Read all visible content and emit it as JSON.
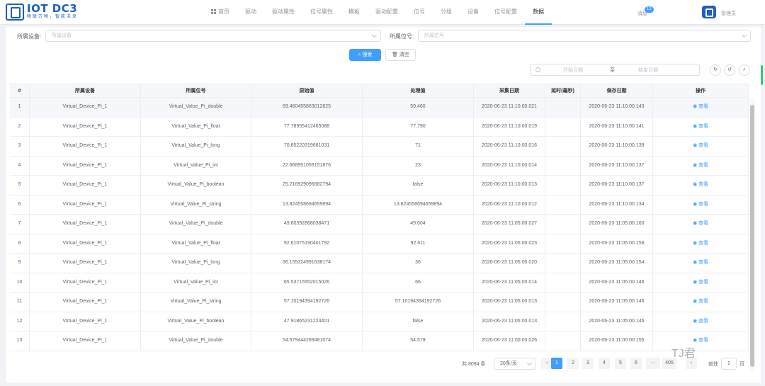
{
  "app": {
    "title": "IOT DC3",
    "subtitle": "物联万物，智能未来"
  },
  "nav": [
    {
      "label": "首页",
      "icon": "grid-icon"
    },
    {
      "label": "驱动"
    },
    {
      "label": "驱动属性"
    },
    {
      "label": "位号属性"
    },
    {
      "label": "模板"
    },
    {
      "label": "驱动配置"
    },
    {
      "label": "位号"
    },
    {
      "label": "分组"
    },
    {
      "label": "设备"
    },
    {
      "label": "位号配置"
    },
    {
      "label": "数据",
      "active": true
    }
  ],
  "header": {
    "messages_label": "消息",
    "messages_count": "12",
    "user_name": "管理员"
  },
  "filters": {
    "device_label": "所属设备:",
    "device_placeholder": "所属设备",
    "point_label": "所属位号:",
    "point_placeholder": "所属位号",
    "search_label": "搜索",
    "clear_label": "清空",
    "start_date_placeholder": "开始日期",
    "range_sep": "至",
    "end_date_placeholder": "结束日期"
  },
  "table": {
    "columns": [
      "#",
      "所属设备",
      "所属位号",
      "原始值",
      "处理值",
      "采集日期",
      "延时(毫秒)",
      "保存日期",
      "操作"
    ],
    "action_label": "查看",
    "rows": [
      [
        "1",
        "Virtual_Device_Pi_1",
        "Virtual_Value_Pi_double",
        "59.460455863012825",
        "59.460",
        "2020-06-23 11:10:00.021",
        "",
        "2020-06-23 11:10:00.143"
      ],
      [
        "2",
        "Virtual_Device_Pi_1",
        "Virtual_Value_Pi_float",
        "77.78955412465088",
        "77.790",
        "2020-06-23 11:10:00.019",
        "",
        "2020-06-23 11:10:00.141"
      ],
      [
        "3",
        "Virtual_Device_Pi_1",
        "Virtual_Value_Pi_long",
        "70.85220319681031",
        "71",
        "2020-06-23 11:10:00.016",
        "",
        "2020-06-23 11:10:00.139"
      ],
      [
        "4",
        "Virtual_Device_Pi_1",
        "Virtual_Value_Pi_int",
        "22.668951059151876",
        "23",
        "2020-06-23 11:10:00.014",
        "",
        "2020-06-23 11:10:00.137"
      ],
      [
        "5",
        "Virtual_Device_Pi_1",
        "Virtual_Value_Pi_boolean",
        "25.216929096682794",
        "false",
        "2020-06-23 11:10:00.013",
        "",
        "2020-06-23 11:10:00.137"
      ],
      [
        "6",
        "Virtual_Device_Pi_1",
        "Virtual_Value_Pi_string",
        "13.824558694659894",
        "13.824558694659894",
        "2020-06-23 11:10:00.012",
        "",
        "2020-06-23 11:10:00.134"
      ],
      [
        "7",
        "Virtual_Device_Pi_1",
        "Virtual_Value_Pi_double",
        "49.60392868038471",
        "49.604",
        "2020-06-23 11:05:00.027",
        "",
        "2020-06-23 11:05:00.160"
      ],
      [
        "8",
        "Virtual_Device_Pi_1",
        "Virtual_Value_Pi_float",
        "92.61075190401792",
        "92.611",
        "2020-06-23 11:05:00.023",
        "",
        "2020-06-23 11:05:00.158"
      ],
      [
        "9",
        "Virtual_Device_Pi_1",
        "Virtual_Value_Pi_long",
        "36.155324991638174",
        "36",
        "2020-06-23 11:05:00.020",
        "",
        "2020-06-23 11:05:00.154"
      ],
      [
        "10",
        "Virtual_Device_Pi_1",
        "Virtual_Value_Pi_int",
        "65.53715552015026",
        "66",
        "2020-06-23 11:05:00.014",
        "",
        "2020-06-23 11:05:00.146"
      ],
      [
        "11",
        "Virtual_Device_Pi_1",
        "Virtual_Value_Pi_string",
        "57.10194394192726",
        "57.10194394192726",
        "2020-06-23 11:05:00.013",
        "",
        "2020-06-23 11:05:00.146"
      ],
      [
        "12",
        "Virtual_Device_Pi_1",
        "Virtual_Value_Pi_boolean",
        "47.91865231224401",
        "false",
        "2020-06-23 11:05:00.013",
        "",
        "2020-06-23 11:05:00.146"
      ],
      [
        "13",
        "Virtual_Device_Pi_1",
        "Virtual_Value_Pi_double",
        "54.579444289481074",
        "54.579",
        "2020-06-23 11:00:00.026",
        "",
        "2020-06-23 11:00:00.155"
      ]
    ]
  },
  "pagination": {
    "total": "共 8094 条",
    "page_size": "20条/页",
    "pages": [
      "1",
      "2",
      "3",
      "4",
      "5",
      "6",
      "···",
      "405"
    ],
    "goto_label": "前往",
    "current": "1",
    "page_suffix": "页"
  },
  "watermark": "TJ君",
  "colors": {
    "primary": "#409eff",
    "brand": "#1f5fb8"
  }
}
